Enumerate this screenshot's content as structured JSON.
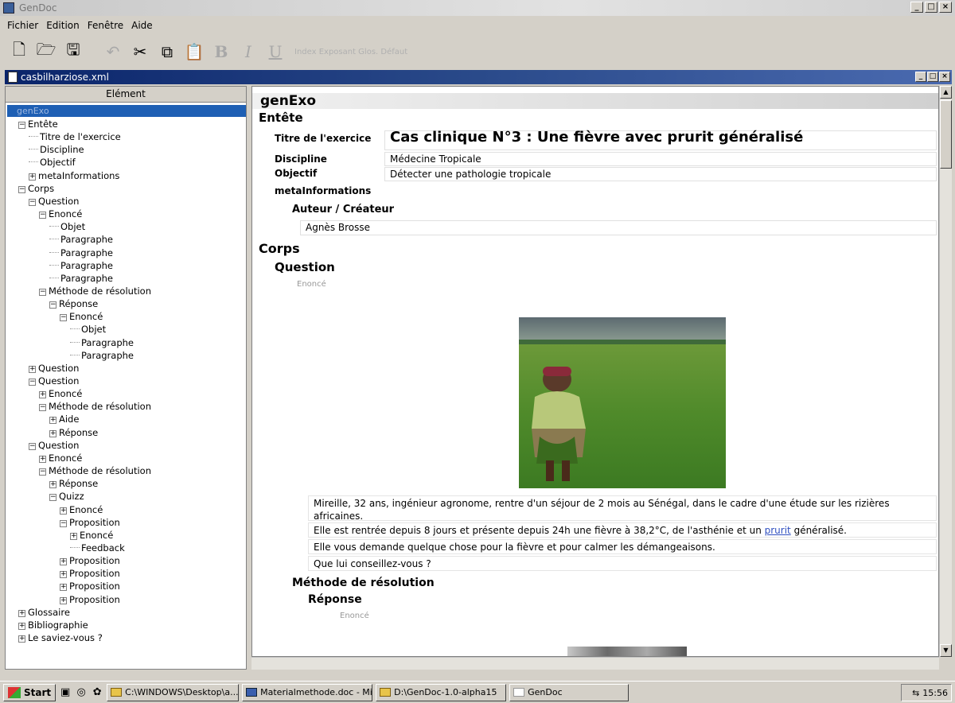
{
  "window": {
    "title": "GenDoc"
  },
  "menu": {
    "items": [
      "Fichier",
      "Edition",
      "Fenêtre",
      "Aide"
    ]
  },
  "toolbar": {
    "icons": [
      "new-file-icon",
      "open-folder-icon",
      "save-icon",
      "undo-icon",
      "cut-icon",
      "copy-icon",
      "paste-icon",
      "bold-icon",
      "italic-icon",
      "underline-icon"
    ],
    "text_buttons": "Index Exposant Glos. Défaut"
  },
  "document": {
    "filename": "casbilharziose.xml"
  },
  "tree": {
    "header": "Elément",
    "root": "genExo",
    "nodes": [
      {
        "label": "Entête",
        "exp": "minus"
      },
      {
        "label": "Titre de l'exercice",
        "exp": ""
      },
      {
        "label": "Discipline",
        "exp": ""
      },
      {
        "label": "Objectif",
        "exp": ""
      },
      {
        "label": "metaInformations",
        "exp": "plus"
      },
      {
        "label": "Corps",
        "exp": "minus"
      },
      {
        "label": "Question",
        "exp": "minus"
      },
      {
        "label": "Enoncé",
        "exp": "minus"
      },
      {
        "label": "Objet",
        "exp": ""
      },
      {
        "label": "Paragraphe",
        "exp": ""
      },
      {
        "label": "Paragraphe",
        "exp": ""
      },
      {
        "label": "Paragraphe",
        "exp": ""
      },
      {
        "label": "Paragraphe",
        "exp": ""
      },
      {
        "label": "Méthode de résolution",
        "exp": "minus"
      },
      {
        "label": "Réponse",
        "exp": "minus"
      },
      {
        "label": "Enoncé",
        "exp": "minus"
      },
      {
        "label": "Objet",
        "exp": ""
      },
      {
        "label": "Paragraphe",
        "exp": ""
      },
      {
        "label": "Paragraphe",
        "exp": ""
      },
      {
        "label": "Question",
        "exp": "plus"
      },
      {
        "label": "Question",
        "exp": "minus"
      },
      {
        "label": "Enoncé",
        "exp": "plus"
      },
      {
        "label": "Méthode de résolution",
        "exp": "minus"
      },
      {
        "label": "Aide",
        "exp": "plus"
      },
      {
        "label": "Réponse",
        "exp": "plus"
      },
      {
        "label": "Question",
        "exp": "minus"
      },
      {
        "label": "Enoncé",
        "exp": "plus"
      },
      {
        "label": "Méthode de résolution",
        "exp": "minus"
      },
      {
        "label": "Réponse",
        "exp": "plus"
      },
      {
        "label": "Quizz",
        "exp": "minus"
      },
      {
        "label": "Enoncé",
        "exp": "plus"
      },
      {
        "label": "Proposition",
        "exp": "minus"
      },
      {
        "label": "Enoncé",
        "exp": "plus"
      },
      {
        "label": "Feedback",
        "exp": ""
      },
      {
        "label": "Proposition",
        "exp": "plus"
      },
      {
        "label": "Proposition",
        "exp": "plus"
      },
      {
        "label": "Proposition",
        "exp": "plus"
      },
      {
        "label": "Proposition",
        "exp": "plus"
      },
      {
        "label": "Glossaire",
        "exp": "plus"
      },
      {
        "label": "Bibliographie",
        "exp": "plus"
      },
      {
        "label": "Le saviez-vous ?",
        "exp": "plus"
      }
    ]
  },
  "content": {
    "root_title": "genExo",
    "entete": {
      "heading": "Entête",
      "titre_label": "Titre de l'exercice",
      "titre_value": "Cas clinique N°3 : Une fièvre avec prurit généralisé",
      "discipline_label": "Discipline",
      "discipline_value": "Médecine Tropicale",
      "objectif_label": "Objectif",
      "objectif_value": "Détecter une pathologie tropicale",
      "meta_label": "metaInformations",
      "auteur_label": "Auteur / Créateur",
      "auteur_value": "Agnès Brosse"
    },
    "corps": {
      "heading": "Corps",
      "question": "Question",
      "enonce": "Enoncé",
      "paragraphs": [
        "Mireille, 32 ans, ingénieur agronome, rentre d'un séjour de 2 mois au Sénégal, dans le cadre d'une étude sur les rizières africaines.",
        "Elle vous demande quelque chose pour la fièvre et pour calmer les démangeaisons.",
        "Que lui conseillez-vous ?"
      ],
      "para2_before": "Elle est rentrée depuis 8 jours et présente depuis 24h une fièvre à 38,2°C, de l'asthénie et un ",
      "para2_link": "prurit",
      "para2_after": " généralisé.",
      "methode": "Méthode de résolution",
      "reponse": "Réponse",
      "reponse_enonce": "Enoncé"
    }
  },
  "taskbar": {
    "start": "Start",
    "tasks": [
      "C:\\WINDOWS\\Desktop\\a...",
      "Materialmethode.doc - Mic...",
      "D:\\GenDoc-1.0-alpha15",
      "GenDoc"
    ],
    "clock": "15:56"
  }
}
